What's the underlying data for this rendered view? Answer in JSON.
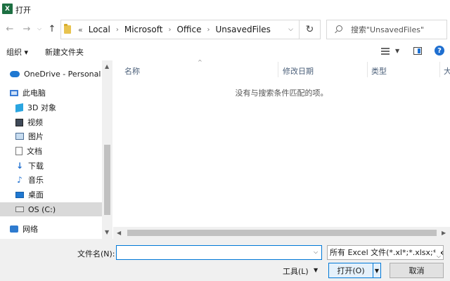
{
  "window": {
    "title": "打开",
    "app_icon_letter": "X"
  },
  "nav": {
    "back": "←",
    "forward": "→",
    "up": "↑"
  },
  "address": {
    "prefix": "«",
    "crumbs": [
      "Local",
      "Microsoft",
      "Office",
      "UnsavedFiles"
    ],
    "separator": "›",
    "dropdown": "⌵",
    "refresh": "↻"
  },
  "search": {
    "placeholder": "搜索\"UnsavedFiles\""
  },
  "toolbar": {
    "organize": "组织 ▾",
    "new_folder": "新建文件夹",
    "help": "?"
  },
  "sidebar": {
    "items": [
      {
        "label": "OneDrive - Personal",
        "icon": "cloud-icon"
      },
      {
        "label": "此电脑",
        "icon": "computer-icon"
      },
      {
        "label": "3D 对象",
        "icon": "cube-icon"
      },
      {
        "label": "视频",
        "icon": "video-icon"
      },
      {
        "label": "图片",
        "icon": "picture-icon"
      },
      {
        "label": "文档",
        "icon": "document-icon"
      },
      {
        "label": "下载",
        "icon": "download-icon"
      },
      {
        "label": "音乐",
        "icon": "music-icon"
      },
      {
        "label": "桌面",
        "icon": "desktop-icon"
      },
      {
        "label": "OS (C:)",
        "icon": "drive-icon",
        "selected": true
      },
      {
        "label": "网络",
        "icon": "network-icon"
      }
    ]
  },
  "file_list": {
    "columns": [
      "名称",
      "修改日期",
      "类型",
      "大"
    ],
    "empty_message": "没有与搜索条件匹配的项。"
  },
  "bottom": {
    "filename_label": "文件名(N):",
    "filename_value": "",
    "filter": "所有 Excel 文件(*.xl*;*.xlsx;*.xl",
    "tools": "工具(L)",
    "open": "打开(O)",
    "cancel": "取消"
  }
}
